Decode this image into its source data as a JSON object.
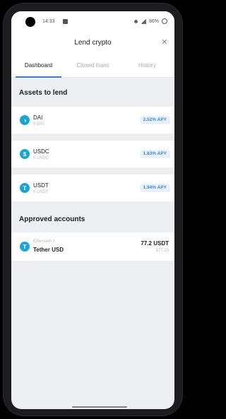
{
  "status_bar": {
    "time": "14:33",
    "battery": "86%"
  },
  "header": {
    "title": "Lend crypto",
    "close_icon": "close-icon"
  },
  "tabs": [
    {
      "label": "Dashboard",
      "active": true
    },
    {
      "label": "Closed loans",
      "active": false
    },
    {
      "label": "History",
      "active": false
    }
  ],
  "assets_section": {
    "title": "Assets to lend",
    "items": [
      {
        "name": "DAI",
        "balance": "0 DAI",
        "apy": "2.52% APY",
        "icon": "dai-icon",
        "color": "#1aa5d4"
      },
      {
        "name": "USDC",
        "balance": "0 USDC",
        "apy": "1.83% APY",
        "icon": "usdc-icon",
        "color": "#2f7de1"
      },
      {
        "name": "USDT",
        "balance": "0 USDT",
        "apy": "1.94% APY",
        "icon": "usdt-icon",
        "color": "#26a17b"
      }
    ]
  },
  "accounts_section": {
    "title": "Approved accounts",
    "items": [
      {
        "network": "Ethereum 1",
        "name": "Tether USD",
        "amount": "77.2 USDT",
        "fiat": "$77.20",
        "icon": "usdt-icon",
        "color": "#26a17b"
      }
    ]
  }
}
